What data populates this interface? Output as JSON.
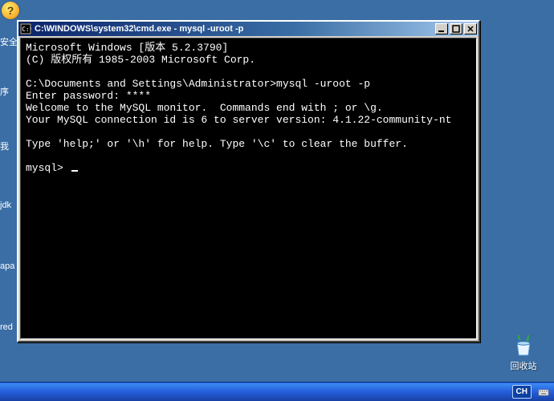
{
  "desktop": {
    "left_labels": {
      "l0": "安全",
      "l1": "序",
      "l2": "我",
      "l3": "jdk",
      "l4": "apa",
      "l5": "red"
    },
    "recycle_bin_label": "回收站",
    "taskbar": {
      "lang": "CH"
    }
  },
  "window": {
    "title": "C:\\WINDOWS\\system32\\cmd.exe - mysql -uroot -p"
  },
  "terminal": {
    "line_win_ver": "Microsoft Windows [版本 5.2.3790]",
    "line_copyright": "(C) 版权所有 1985-2003 Microsoft Corp.",
    "blank1": "",
    "line_path_cmd": "C:\\Documents and Settings\\Administrator>mysql -uroot -p",
    "line_enter_pw": "Enter password: ****",
    "line_welcome": "Welcome to the MySQL monitor.  Commands end with ; or \\g.",
    "line_conn": "Your MySQL connection id is 6 to server version: 4.1.22-community-nt",
    "blank2": "",
    "line_help": "Type 'help;' or '\\h' for help. Type '\\c' to clear the buffer.",
    "blank3": "",
    "line_prompt": "mysql> "
  }
}
